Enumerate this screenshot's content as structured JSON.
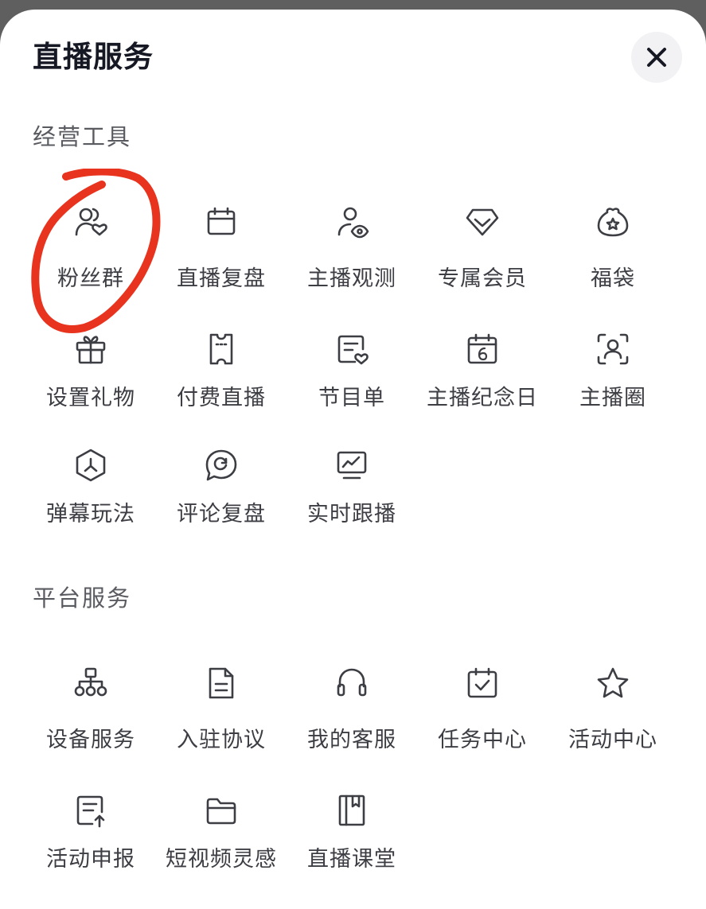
{
  "header": {
    "title": "直播服务",
    "close_icon": "close-icon"
  },
  "sections": [
    {
      "label": "经营工具",
      "items": [
        {
          "label": "粉丝群",
          "icon": "fan-group-icon"
        },
        {
          "label": "直播复盘",
          "icon": "calendar-icon"
        },
        {
          "label": "主播观测",
          "icon": "user-eye-icon"
        },
        {
          "label": "专属会员",
          "icon": "diamond-icon"
        },
        {
          "label": "福袋",
          "icon": "lucky-bag-icon"
        },
        {
          "label": "设置礼物",
          "icon": "gift-icon"
        },
        {
          "label": "付费直播",
          "icon": "ticket-icon"
        },
        {
          "label": "节目单",
          "icon": "program-list-icon"
        },
        {
          "label": "主播纪念日",
          "icon": "anniversary-calendar-icon"
        },
        {
          "label": "主播圈",
          "icon": "user-scan-icon"
        },
        {
          "label": "弹幕玩法",
          "icon": "danmaku-icon"
        },
        {
          "label": "评论复盘",
          "icon": "comment-replay-icon"
        },
        {
          "label": "实时跟播",
          "icon": "monitor-chart-icon"
        }
      ]
    },
    {
      "label": "平台服务",
      "items": [
        {
          "label": "设备服务",
          "icon": "hierarchy-icon"
        },
        {
          "label": "入驻协议",
          "icon": "document-icon"
        },
        {
          "label": "我的客服",
          "icon": "headset-icon"
        },
        {
          "label": "任务中心",
          "icon": "calendar-check-icon"
        },
        {
          "label": "活动中心",
          "icon": "star-icon"
        },
        {
          "label": "活动申报",
          "icon": "report-upload-icon"
        },
        {
          "label": "短视频灵感",
          "icon": "folder-icon"
        },
        {
          "label": "直播课堂",
          "icon": "notebook-icon"
        }
      ]
    }
  ],
  "colors": {
    "annotation": "#e8331e",
    "icon": "#3d3e44",
    "text": "#3d3e44"
  }
}
